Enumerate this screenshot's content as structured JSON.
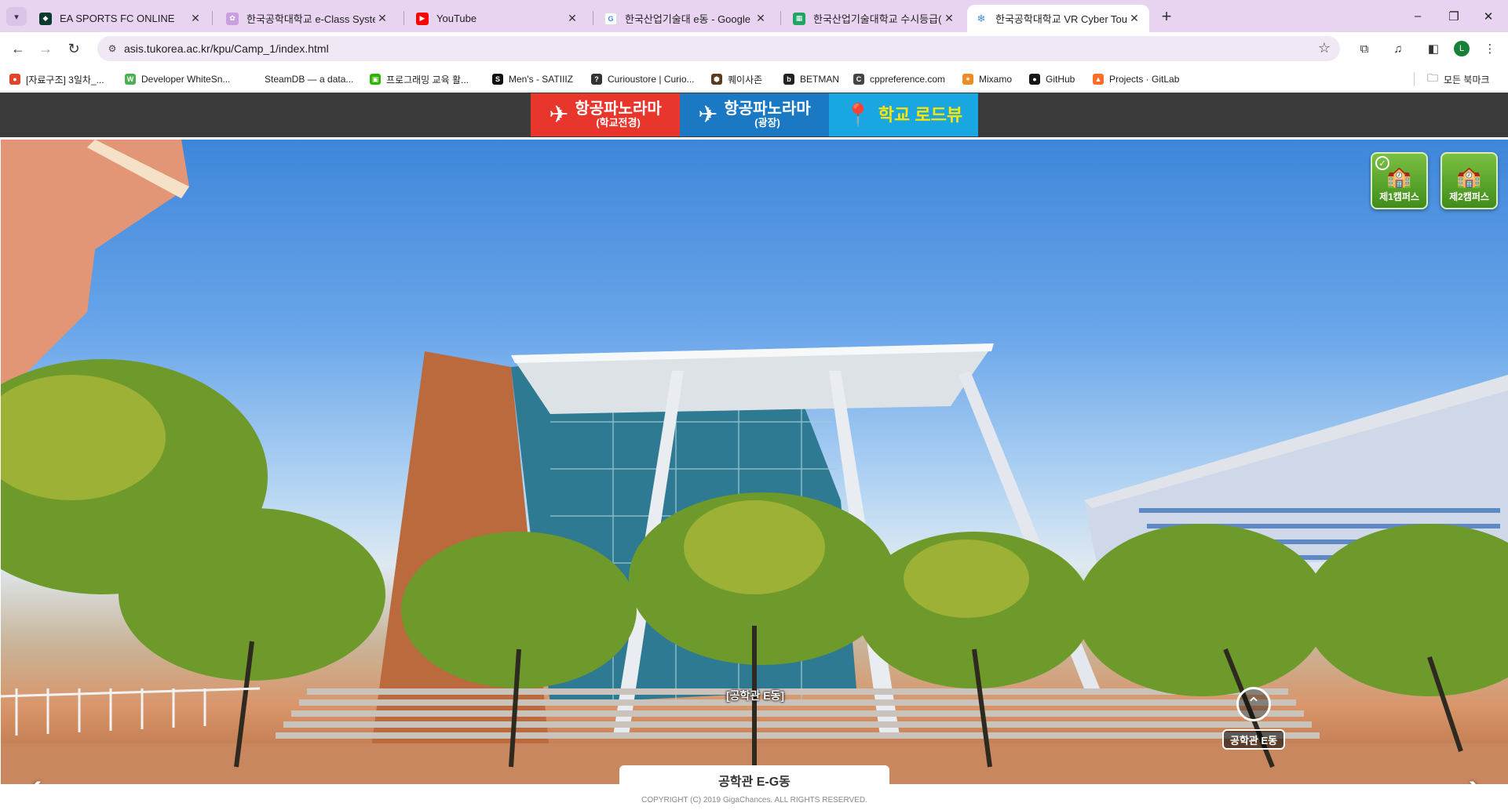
{
  "browser": {
    "tabs": [
      {
        "title": "EA SPORTS FC ONLINE",
        "favicon": "shield-icon",
        "color": "#0b3b2e"
      },
      {
        "title": "한국공학대학교 e-Class System",
        "favicon": "flower-icon",
        "color": "#c8a0e0"
      },
      {
        "title": "YouTube",
        "favicon": "youtube-icon",
        "color": "#ff0000"
      },
      {
        "title": "한국산업기술대 e동 - Google",
        "favicon": "google-icon",
        "color": "#4285f4"
      },
      {
        "title": "한국산업기술대학교 수시등급(",
        "favicon": "sheet-icon",
        "color": "#1fa463"
      },
      {
        "title": "한국공학대학교 VR Cyber Tour",
        "favicon": "snowflake-icon",
        "color": "#3b8fd9"
      }
    ],
    "new_tab": "+",
    "window": {
      "minimize": "–",
      "restore": "❐",
      "close": "✕"
    },
    "url": "asis.tukorea.ac.kr/kpu/Camp_1/index.html",
    "profile_initial": "L",
    "bookmarks": [
      {
        "label": "[자료구조] 3일차_...",
        "color": "#e0452a",
        "glyph": "●"
      },
      {
        "label": "Developer WhiteSn...",
        "color": "#4caf50",
        "glyph": "W"
      },
      {
        "label": "SteamDB — a data...",
        "color": "#ffffff",
        "glyph": ""
      },
      {
        "label": "프로그래밍 교육 활...",
        "color": "#2db400",
        "glyph": "▣"
      },
      {
        "label": "Men's - SATIIIZ",
        "color": "#111111",
        "glyph": "S"
      },
      {
        "label": "Curioustore | Curio...",
        "color": "#333333",
        "glyph": "?"
      },
      {
        "label": "퀘이사존",
        "color": "#5a3b1f",
        "glyph": "⬢"
      },
      {
        "label": "BETMAN",
        "color": "#222222",
        "glyph": "b"
      },
      {
        "label": "cppreference.com",
        "color": "#444444",
        "glyph": "C"
      },
      {
        "label": "Mixamo",
        "color": "#f08a24",
        "glyph": "✶"
      },
      {
        "label": "GitHub",
        "color": "#181717",
        "glyph": "●"
      },
      {
        "label": "Projects · GitLab",
        "color": "#fc6d26",
        "glyph": "▲"
      }
    ],
    "all_bookmarks": "모든 북마크"
  },
  "site": {
    "menu": [
      {
        "line1": "항공파노라마",
        "line2": "(학교전경)",
        "color": "#e8362d",
        "icon": "airplane-icon"
      },
      {
        "line1": "항공파노라마",
        "line2": "(광장)",
        "color": "#1b78c2",
        "icon": "airplane-icon"
      },
      {
        "line1": "학교 로드뷰",
        "line2": "",
        "color": "#1aa6e0",
        "icon": "map-pin-icon"
      }
    ],
    "campus": [
      {
        "label": "제1캠퍼스",
        "selected": true
      },
      {
        "label": "제2캠퍼스",
        "selected": false
      }
    ],
    "building_label": "[공학관 E동]",
    "hotspot_label": "공학관 E동",
    "controls": {
      "zoom_in": "+",
      "zoom_out": "−",
      "pause": "⏸",
      "fullscreen": "⛶"
    },
    "prev": "‹",
    "next": "›",
    "caption_title": "공학관 E-G동",
    "copyright": "COPYRIGHT (C) 2019 GigaChances. ALL RIGHTS RESERVED."
  }
}
